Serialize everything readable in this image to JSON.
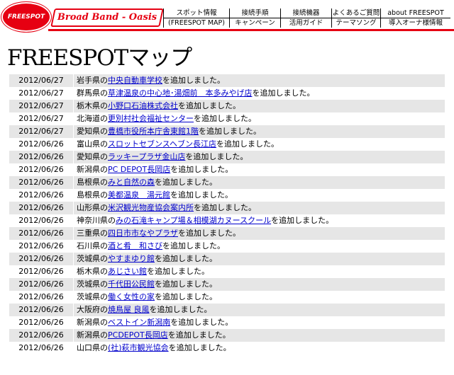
{
  "header": {
    "logo_text": "FREESPOT",
    "brand": "Broad Band - Oasis",
    "nav_top": [
      "スポット情報",
      "接続手順",
      "接続機器",
      "よくあるご質問",
      "about FREESPOT"
    ],
    "nav_bottom": [
      "(FREESPOT MAP)",
      "キャンペーン",
      "活用ガイド",
      "テーマソング",
      "導入オーナ様情報"
    ]
  },
  "page_title": "FREESPOTマップ",
  "rows": [
    {
      "date": "2012/06/27",
      "pref": "岩手県の",
      "link": "中央自動車学校",
      "suffix": "を追加しました。"
    },
    {
      "date": "2012/06/27",
      "pref": "群馬県の",
      "link": "草津温泉の中心地･湯畑前　本多みやげ店",
      "suffix": "を追加しました。"
    },
    {
      "date": "2012/06/27",
      "pref": "栃木県の",
      "link": "小野口石油株式会社",
      "suffix": "を追加しました。"
    },
    {
      "date": "2012/06/27",
      "pref": "北海道の",
      "link": "更別村社会福祉センター",
      "suffix": "を追加しました。"
    },
    {
      "date": "2012/06/27",
      "pref": "愛知県の",
      "link": "豊橋市役所本庁舎東館1階",
      "suffix": "を追加しました。"
    },
    {
      "date": "2012/06/26",
      "pref": "富山県の",
      "link": "スロットセブンスヘブン長江店",
      "suffix": "を追加しました。"
    },
    {
      "date": "2012/06/26",
      "pref": "愛知県の",
      "link": "ラッキープラザ金山店",
      "suffix": "を追加しました。"
    },
    {
      "date": "2012/06/26",
      "pref": "新潟県の",
      "link": "PC DEPOT長岡店",
      "suffix": "を追加しました。"
    },
    {
      "date": "2012/06/26",
      "pref": "島根県の",
      "link": "みと自然の森",
      "suffix": "を追加しました。"
    },
    {
      "date": "2012/06/26",
      "pref": "島根県の",
      "link": "美都温泉　湯元館",
      "suffix": "を追加しました。"
    },
    {
      "date": "2012/06/26",
      "pref": "山形県の",
      "link": "米沢観光物産協会案内所",
      "suffix": "を追加しました。"
    },
    {
      "date": "2012/06/26",
      "pref": "神奈川県の",
      "link": "みの石滝キャンプ場＆相模湖カヌースクール",
      "suffix": "を追加しました。"
    },
    {
      "date": "2012/06/26",
      "pref": "三重県の",
      "link": "四日市市なやプラザ",
      "suffix": "を追加しました。"
    },
    {
      "date": "2012/06/26",
      "pref": "石川県の",
      "link": "酒と肴　和さび",
      "suffix": "を追加しました。"
    },
    {
      "date": "2012/06/26",
      "pref": "茨城県の",
      "link": "やすまゆり館",
      "suffix": "を追加しました。"
    },
    {
      "date": "2012/06/26",
      "pref": "栃木県の",
      "link": "あじさい館",
      "suffix": "を追加しました。"
    },
    {
      "date": "2012/06/26",
      "pref": "茨城県の",
      "link": "千代田公民館",
      "suffix": "を追加しました。"
    },
    {
      "date": "2012/06/26",
      "pref": "茨城県の",
      "link": "働く女性の家",
      "suffix": "を追加しました。"
    },
    {
      "date": "2012/06/26",
      "pref": "大阪府の",
      "link": "焼鳥屋 良風",
      "suffix": "を追加しました。"
    },
    {
      "date": "2012/06/26",
      "pref": "新潟県の",
      "link": "ベストイン新潟南",
      "suffix": "を追加しました。"
    },
    {
      "date": "2012/06/26",
      "pref": "新潟県の",
      "link": "PCDEPOT長岡店",
      "suffix": "を追加しました。"
    },
    {
      "date": "2012/06/26",
      "pref": "山口県の",
      "link": "(社)萩市観光協会",
      "suffix": "を追加しました。"
    }
  ]
}
